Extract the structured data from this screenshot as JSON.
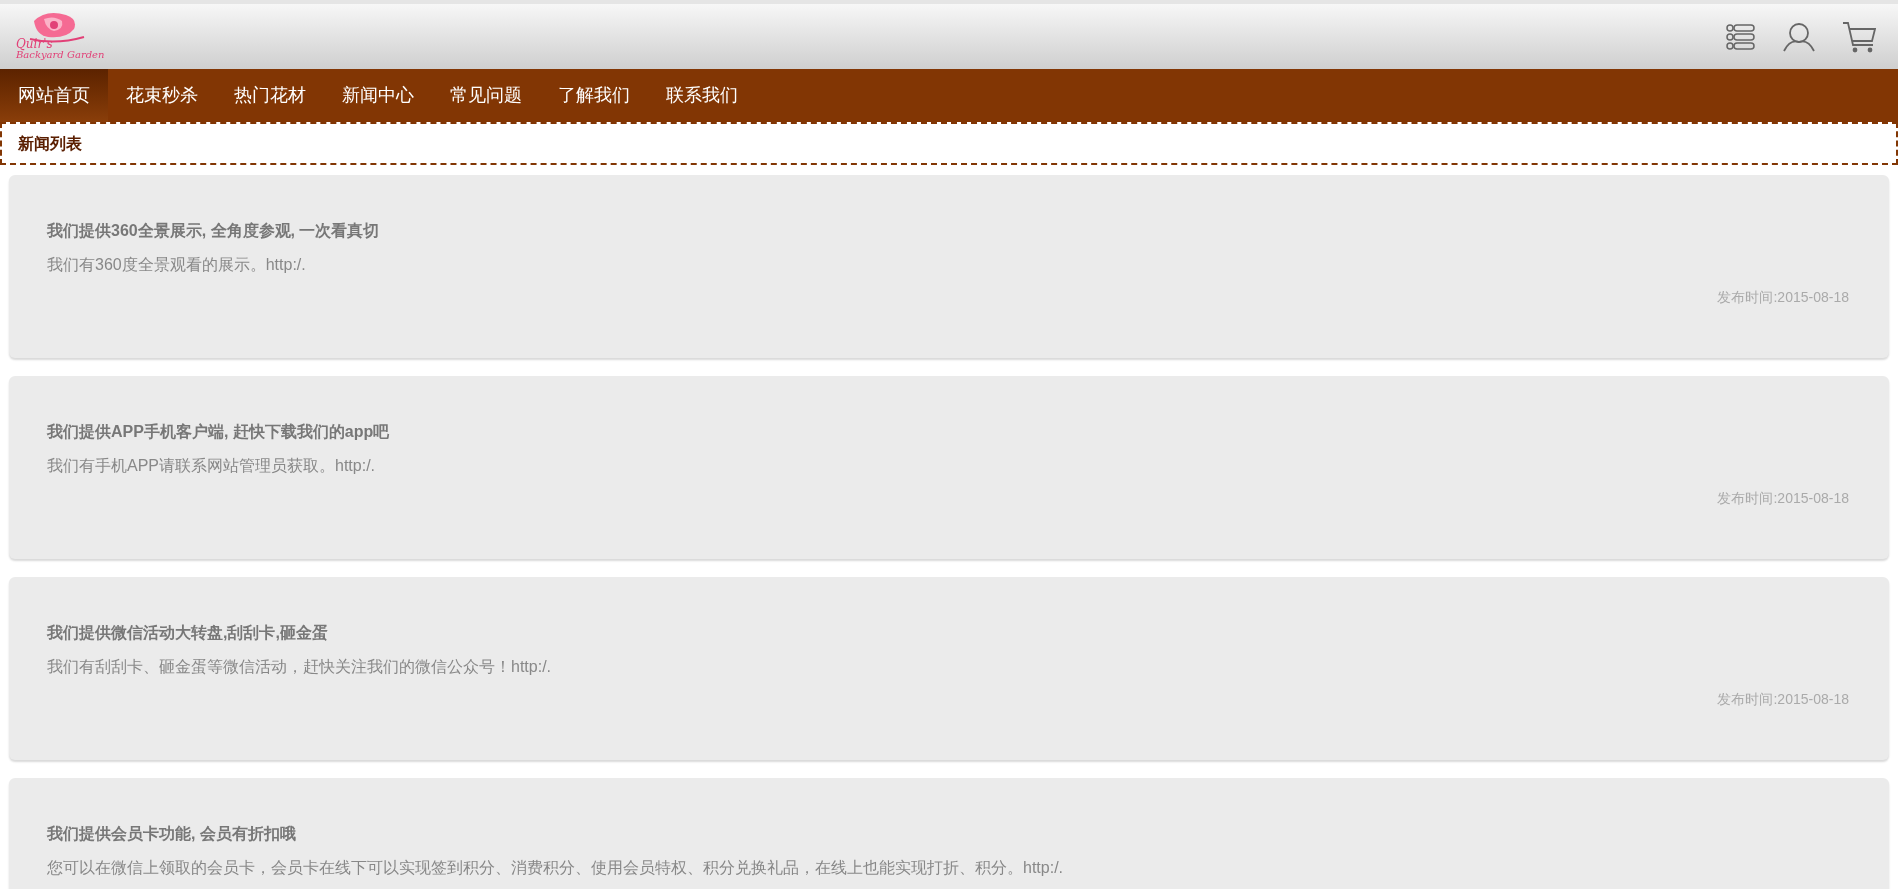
{
  "logo": {
    "line_1": "Quir's",
    "line_2": "Backyard Garden"
  },
  "nav": [
    {
      "label": "网站首页",
      "selected": true
    },
    {
      "label": "花束秒杀",
      "selected": false
    },
    {
      "label": "热门花材",
      "selected": false
    },
    {
      "label": "新闻中心",
      "selected": false
    },
    {
      "label": "常见问题",
      "selected": false
    },
    {
      "label": "了解我们",
      "selected": false
    },
    {
      "label": "联系我们",
      "selected": false
    }
  ],
  "breadcrumb": "新闻列表",
  "news": [
    {
      "title": "我们提供360全景展示, 全角度参观, 一次看真切",
      "summary": "我们有360度全景观看的展示。http:/.",
      "date": "发布时间:2015-08-18"
    },
    {
      "title": "我们提供APP手机客户端, 赶快下载我们的app吧",
      "summary": "我们有手机APP请联系网站管理员获取。http:/.",
      "date": "发布时间:2015-08-18"
    },
    {
      "title": "我们提供微信活动大转盘,刮刮卡,砸金蛋",
      "summary": "我们有刮刮卡、砸金蛋等微信活动，赶快关注我们的微信公众号！http:/.",
      "date": "发布时间:2015-08-18"
    },
    {
      "title": "我们提供会员卡功能, 会员有折扣哦",
      "summary": "您可以在微信上领取的会员卡，会员卡在线下可以实现签到积分、消费积分、使用会员特权、积分兑换礼品，在线上也能实现打折、积分。http:/."
    }
  ]
}
